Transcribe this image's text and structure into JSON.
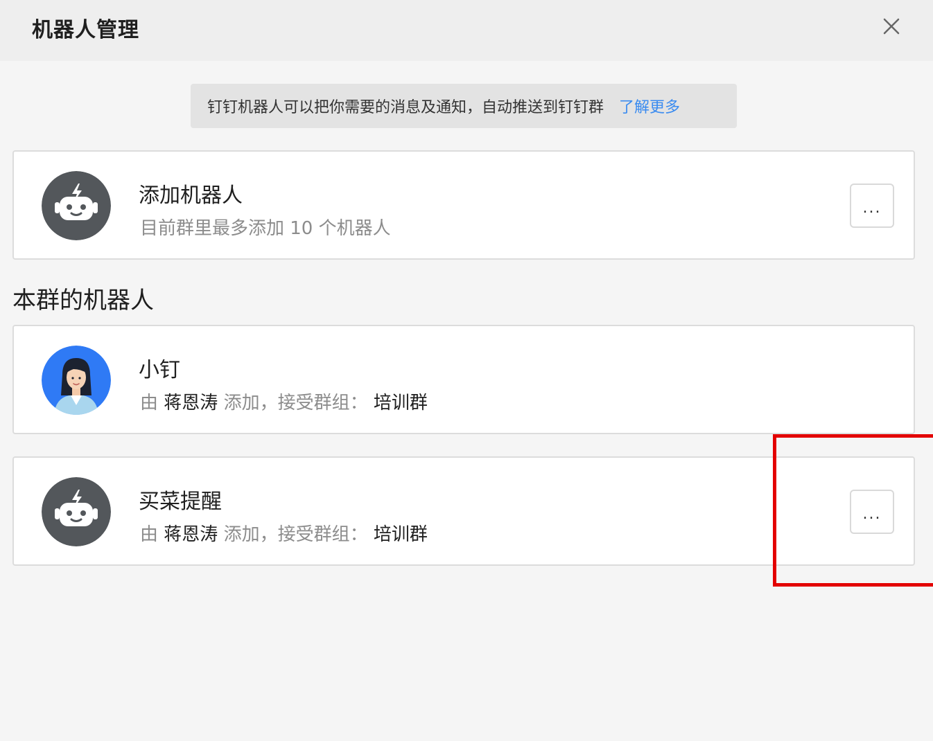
{
  "header": {
    "title": "机器人管理",
    "close_icon": "close-icon"
  },
  "notice": {
    "text": "钉钉机器人可以把你需要的消息及通知，自动推送到钉钉群",
    "link": "了解更多",
    "link_color": "#3a8bf0"
  },
  "add_robot": {
    "title": "添加机器人",
    "subtitle": "目前群里最多添加 10 个机器人",
    "more_label": "...",
    "icon": "robot-icon"
  },
  "section": {
    "title": "本群的机器人"
  },
  "robots": [
    {
      "name": "小钉",
      "by_prefix": "由",
      "added_by": "蒋恩涛",
      "added_text": "添加，接受群组：",
      "group": "培训群",
      "avatar": "woman-avatar-icon"
    },
    {
      "name": "买菜提醒",
      "by_prefix": "由",
      "added_by": "蒋恩涛",
      "added_text": "添加，接受群组：",
      "group": "培训群",
      "more_label": "...",
      "avatar": "robot-icon"
    }
  ],
  "highlight_color": "#e30000"
}
